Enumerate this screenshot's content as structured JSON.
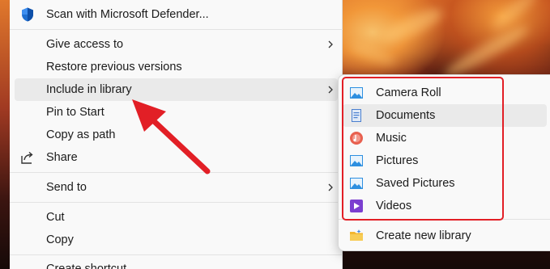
{
  "main_menu": {
    "items": [
      {
        "label": "Scan with Microsoft Defender...",
        "icon": "defender-shield-icon"
      },
      {
        "label": "Give access to",
        "submenu": true
      },
      {
        "label": "Restore previous versions"
      },
      {
        "label": "Include in library",
        "submenu": true
      },
      {
        "label": "Pin to Start"
      },
      {
        "label": "Copy as path"
      },
      {
        "label": "Share",
        "icon": "share-icon"
      },
      {
        "label": "Send to",
        "submenu": true
      },
      {
        "label": "Cut"
      },
      {
        "label": "Copy"
      },
      {
        "label": "Create shortcut"
      }
    ]
  },
  "library_submenu": {
    "items": [
      {
        "label": "Camera Roll",
        "icon": "pictures-library-icon"
      },
      {
        "label": "Documents",
        "icon": "documents-library-icon"
      },
      {
        "label": "Music",
        "icon": "music-library-icon"
      },
      {
        "label": "Pictures",
        "icon": "pictures-library-icon"
      },
      {
        "label": "Saved Pictures",
        "icon": "pictures-library-icon"
      },
      {
        "label": "Videos",
        "icon": "videos-library-icon"
      }
    ],
    "create_new": {
      "label": "Create new library",
      "icon": "new-library-folder-icon"
    }
  },
  "colors": {
    "annotation_red": "#e21f26",
    "menu_bg": "#f9f9f9",
    "hover_bg": "#eaeaea"
  }
}
